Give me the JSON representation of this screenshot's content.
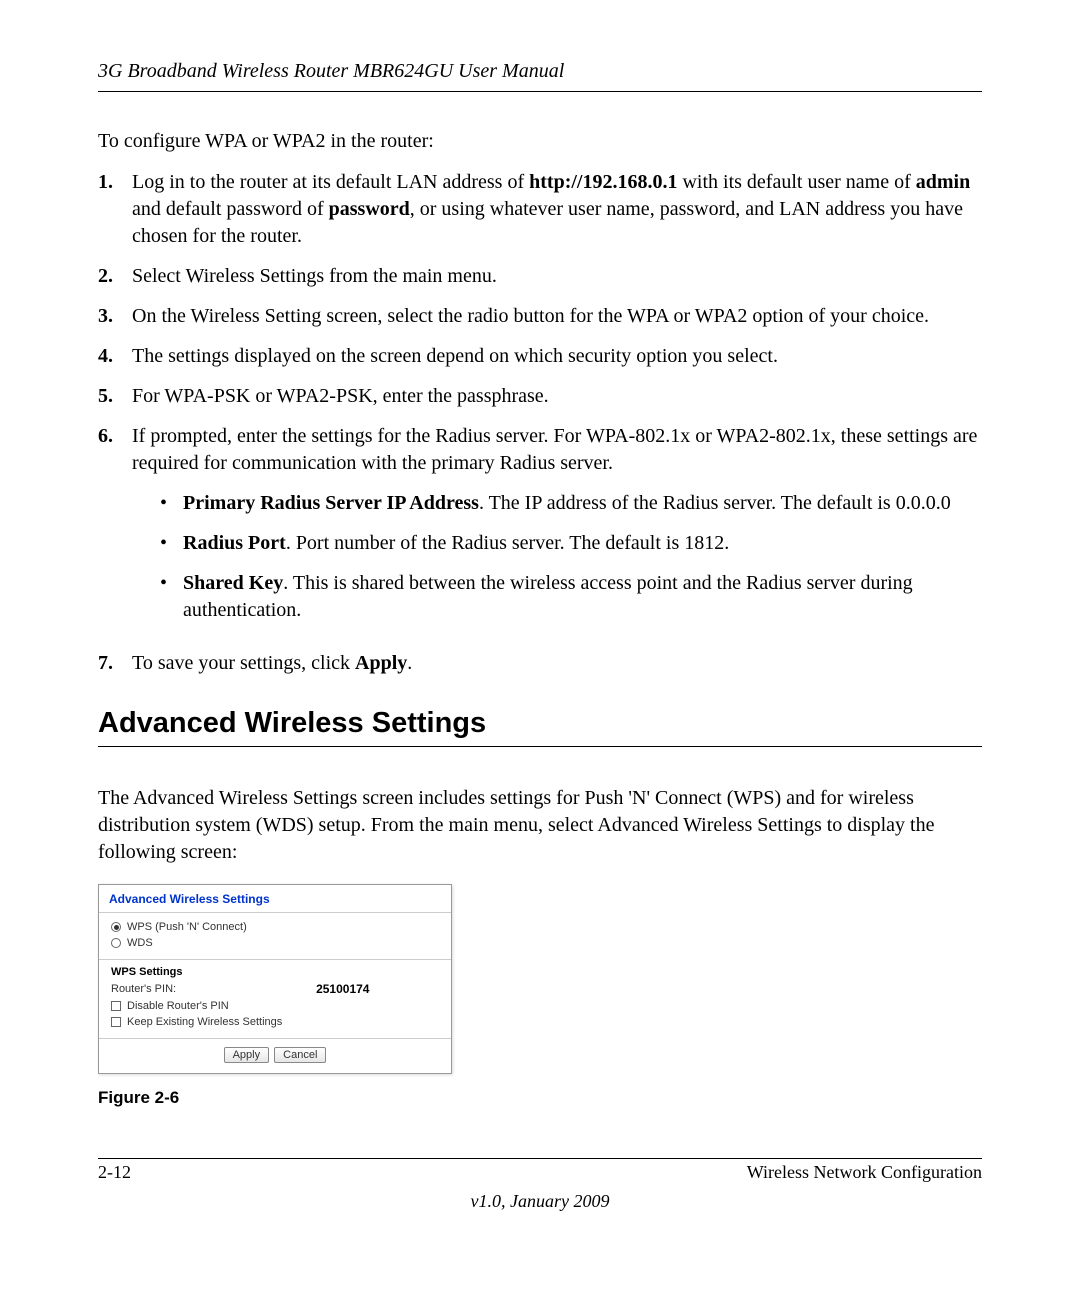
{
  "header": {
    "title": "3G Broadband Wireless Router MBR624GU User Manual"
  },
  "intro": "To configure WPA or WPA2 in the router:",
  "steps": {
    "s1": {
      "pre": "Log in to the router at its default LAN address of ",
      "url": "http://192.168.0.1",
      "mid1": " with its default user name of ",
      "admin": "admin",
      "mid2": " and default password of ",
      "password": "password",
      "post": ", or using whatever user name, password, and LAN address you have chosen for the router."
    },
    "s2": "Select Wireless Settings from the main menu.",
    "s3": "On the Wireless Setting screen, select the radio button for the WPA or WPA2 option of your choice.",
    "s4": "The settings displayed on the screen depend on which security option you select.",
    "s5": "For WPA-PSK or WPA2-PSK, enter the passphrase.",
    "s6": "If prompted, enter the settings for the Radius server. For WPA-802.1x or WPA2-802.1x, these settings are required for communication with the primary Radius server.",
    "b1": {
      "label": "Primary Radius Server IP Address",
      "text": ". The IP address of the Radius server. The default is 0.0.0.0"
    },
    "b2": {
      "label": "Radius Port",
      "text": ". Port number of the Radius server. The default is 1812."
    },
    "b3": {
      "label": "Shared Key",
      "text": ". This is shared between the wireless access point and the Radius server during authentication."
    },
    "s7": {
      "pre": "To save your settings, click ",
      "apply": "Apply",
      "post": "."
    }
  },
  "nums": {
    "n1": "1.",
    "n2": "2.",
    "n3": "3.",
    "n4": "4.",
    "n5": "5.",
    "n6": "6.",
    "n7": "7."
  },
  "bullet": "•",
  "section": {
    "heading": "Advanced Wireless Settings"
  },
  "sectionIntro": "The Advanced Wireless Settings screen includes settings for Push 'N' Connect (WPS) and for wireless distribution system (WDS) setup. From the main menu, select Advanced Wireless Settings to display the following screen:",
  "figure": {
    "title": "Advanced Wireless Settings",
    "opt1": "WPS (Push 'N' Connect)",
    "opt2": "WDS",
    "wpsHeading": "WPS Settings",
    "pinLabel": "Router's PIN:",
    "pinValue": "25100174",
    "chk1": "Disable Router's PIN",
    "chk2": "Keep Existing Wireless Settings",
    "applyBtn": "Apply",
    "cancelBtn": "Cancel",
    "caption": "Figure 2-6"
  },
  "footer": {
    "left": "2-12",
    "right": "Wireless Network Configuration",
    "version": "v1.0, January 2009"
  }
}
